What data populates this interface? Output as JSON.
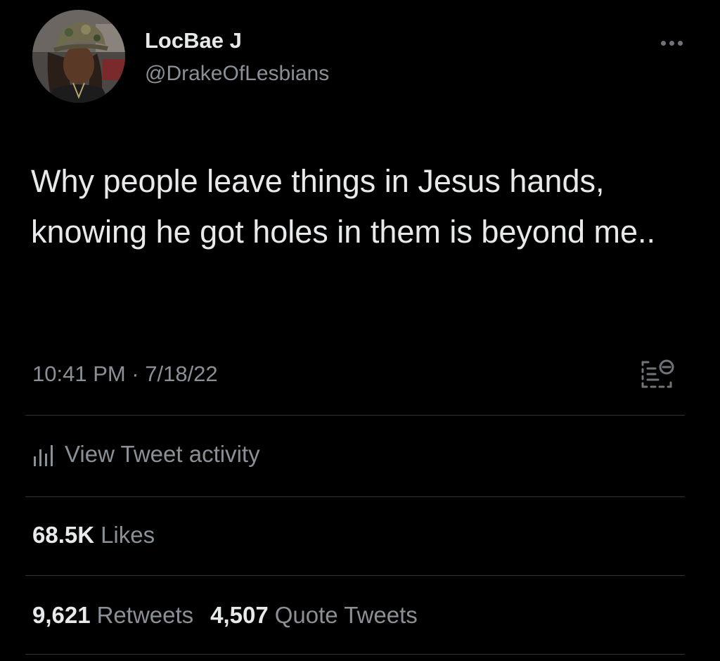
{
  "user": {
    "display_name": "LocBae J",
    "handle": "@DrakeOfLesbians",
    "avatar": "profile-photo-person-in-camo-cap"
  },
  "tweet": {
    "text": "Why people leave things in Jesus hands, knowing he got holes in them is beyond me..",
    "timestamp": "10:41 PM · 7/18/22"
  },
  "icons": {
    "more": "more-horizontal-icon",
    "source": "tweet-source-icon",
    "activity": "bar-chart-icon"
  },
  "activity": {
    "label": "View Tweet activity"
  },
  "stats": {
    "likes_count": "68.5K",
    "likes_label": "Likes",
    "retweets_count": "9,621",
    "retweets_label": "Retweets",
    "quotes_count": "4,507",
    "quotes_label": "Quote Tweets"
  },
  "colors": {
    "background": "#000000",
    "primary_text": "#e7e9ea",
    "secondary_text": "#8b9096",
    "divider": "#2f3336"
  }
}
